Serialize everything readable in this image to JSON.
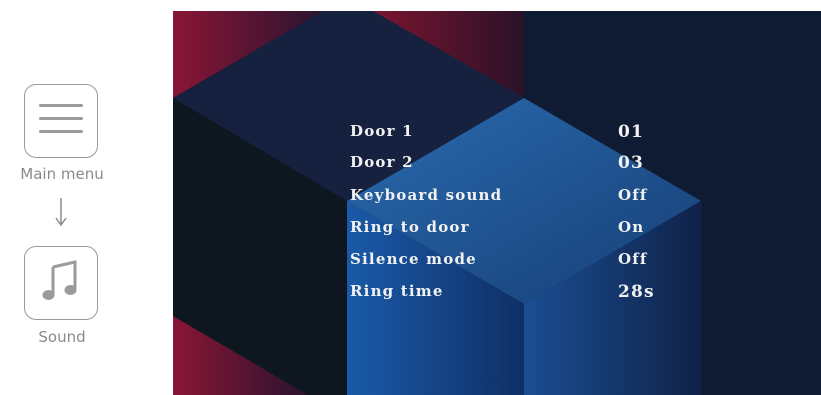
{
  "nav": {
    "main_menu_label": "Main menu",
    "main_menu_icon": "hamburger-menu-icon",
    "sound_label": "Sound",
    "sound_icon": "music-note-icon"
  },
  "settings": [
    {
      "label": "Door 1",
      "value": "01"
    },
    {
      "label": "Door 2",
      "value": "03"
    },
    {
      "label": "Keyboard sound",
      "value": "Off"
    },
    {
      "label": "Ring to door",
      "value": "On"
    },
    {
      "label": "Silence mode",
      "value": "Off"
    },
    {
      "label": "Ring time",
      "value": "28s"
    }
  ],
  "colors": {
    "navy": "#0f1a33",
    "crimson": "#8a1535",
    "blue": "#1c5ba8",
    "text": "#f2f2f2",
    "icon_gray": "#9a9a9a"
  }
}
